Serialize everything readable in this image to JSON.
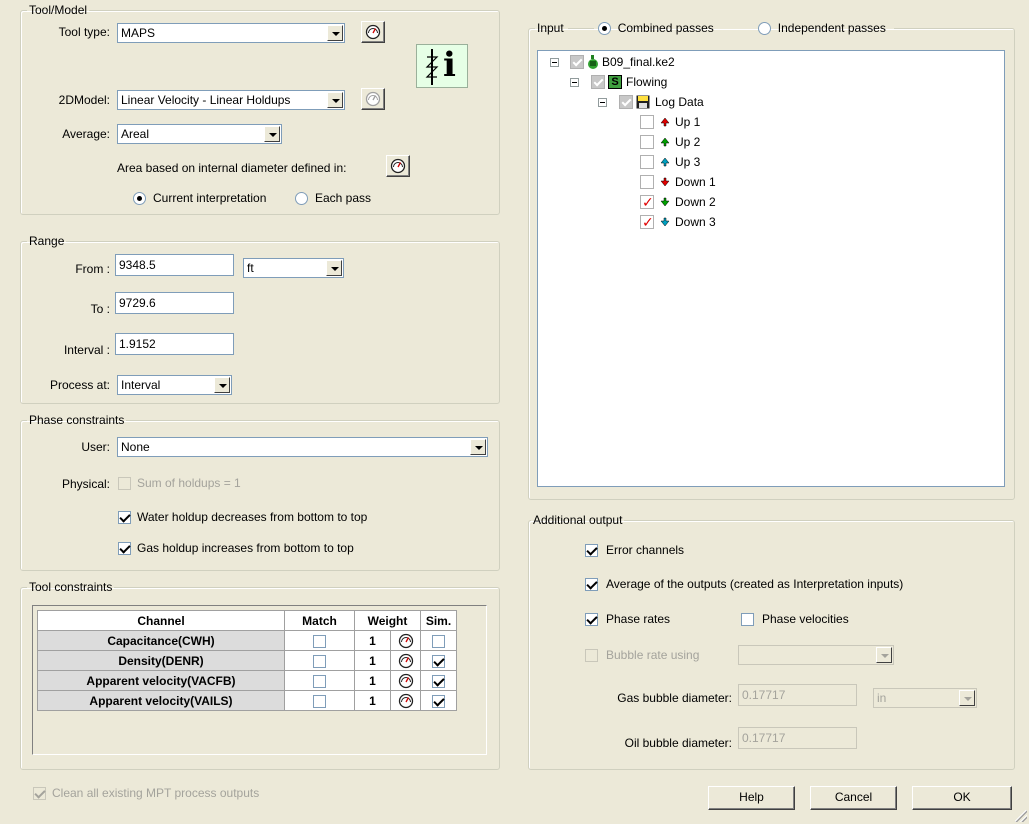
{
  "tool_model": {
    "legend": "Tool/Model",
    "tool_type_label": "Tool type:",
    "tool_type_value": "MAPS",
    "model_label": "2DModel:",
    "model_value": "Linear Velocity - Linear Holdups",
    "average_label": "Average:",
    "average_value": "Areal",
    "area_label": "Area based on internal diameter defined in:",
    "radio_current": "Current interpretation",
    "radio_each": "Each pass",
    "info_icon_text": "i"
  },
  "range": {
    "legend": "Range",
    "from_label": "From :",
    "from_value": "9348.5",
    "unit_value": "ft",
    "to_label": "To :",
    "to_value": "9729.6",
    "interval_label": "Interval :",
    "interval_value": "1.9152",
    "process_label": "Process at:",
    "process_value": "Interval"
  },
  "phase_constraints": {
    "legend": "Phase constraints",
    "user_label": "User:",
    "user_value": "None",
    "physical_label": "Physical:",
    "sum_label": "Sum of holdups = 1",
    "water_label": "Water holdup decreases from bottom to top",
    "gas_label": "Gas holdup increases from bottom to top"
  },
  "tool_constraints": {
    "legend": "Tool constraints",
    "headers": [
      "Channel",
      "Match",
      "Weight",
      "Sim."
    ],
    "rows": [
      {
        "channel": "Capacitance(CWH)",
        "match": false,
        "weight": "1",
        "sim": false
      },
      {
        "channel": "Density(DENR)",
        "match": false,
        "weight": "1",
        "sim": true
      },
      {
        "channel": "Apparent velocity(VACFB)",
        "match": false,
        "weight": "1",
        "sim": true
      },
      {
        "channel": "Apparent velocity(VAILS)",
        "match": false,
        "weight": "1",
        "sim": true
      }
    ]
  },
  "clean_label": "Clean all existing MPT process outputs",
  "input": {
    "legend": "Input",
    "radio_combined": "Combined passes",
    "radio_independent": "Independent passes",
    "tree": {
      "root": "B09_final.ke2",
      "flowing": "Flowing",
      "logdata": "Log Data",
      "passes": [
        "Up 1",
        "Up 2",
        "Up 3",
        "Down 1",
        "Down 2",
        "Down 3"
      ],
      "checked": [
        false,
        false,
        false,
        false,
        true,
        true
      ],
      "colors": {
        "up1": "#e00000",
        "up2": "#00a000",
        "up3": "#00a0c0",
        "down1": "#e00000",
        "down2": "#00a000",
        "down3": "#00a0c0"
      }
    }
  },
  "additional_output": {
    "legend": "Additional output",
    "error_channels": "Error channels",
    "average_outputs": "Average of the outputs (created as Interpretation inputs)",
    "phase_rates": "Phase rates",
    "phase_velocities": "Phase velocities",
    "bubble_rate": "Bubble rate using",
    "gas_bubble_label": "Gas bubble diameter:",
    "gas_bubble_value": "0.17717",
    "gas_unit": "in",
    "oil_bubble_label": "Oil bubble diameter:",
    "oil_bubble_value": "0.17717"
  },
  "buttons": {
    "help": "Help",
    "cancel": "Cancel",
    "ok": "OK"
  }
}
